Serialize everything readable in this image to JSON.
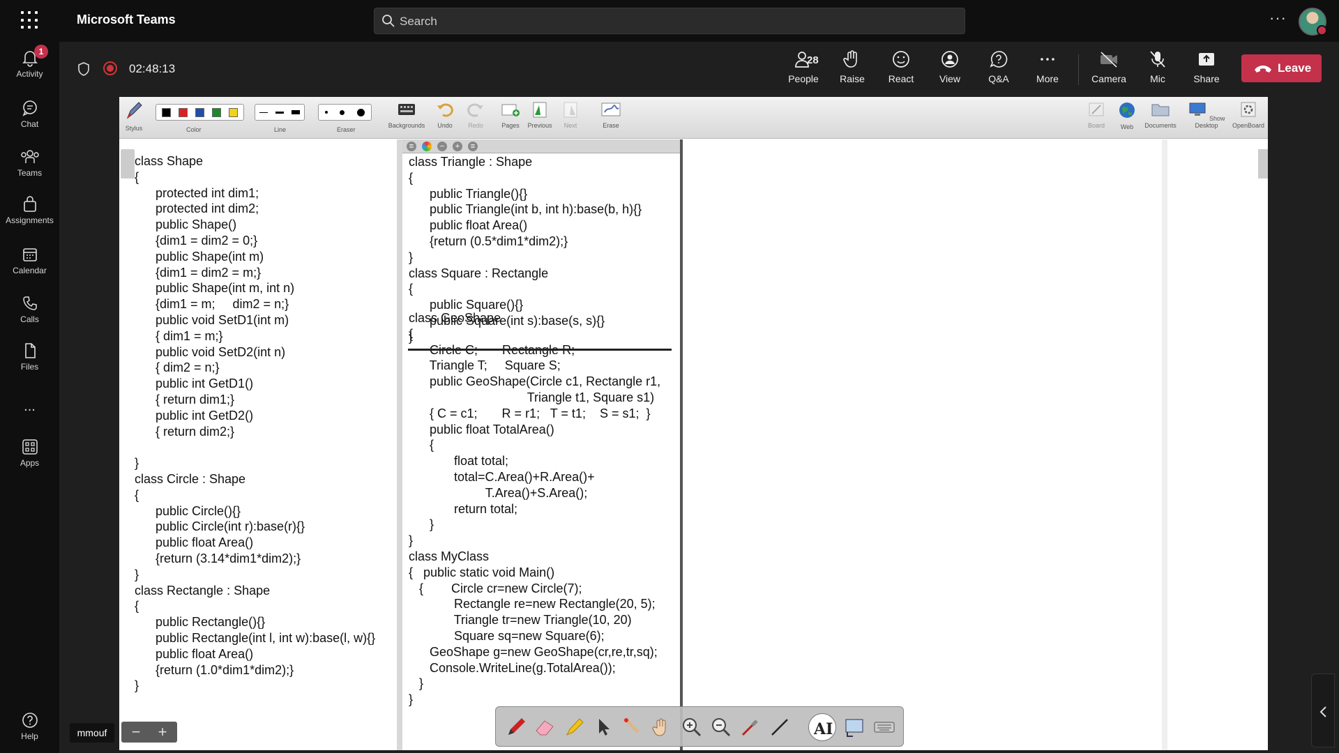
{
  "app": {
    "title": "Microsoft Teams"
  },
  "search": {
    "placeholder": "Search"
  },
  "rail": {
    "activity": {
      "label": "Activity",
      "badge": "1"
    },
    "chat": "Chat",
    "teams": "Teams",
    "assignments": "Assignments",
    "calendar": "Calendar",
    "calls": "Calls",
    "files": "Files",
    "more": "...",
    "apps": "Apps",
    "help": "Help"
  },
  "meeting": {
    "timer": "02:48:13",
    "people_count": "28",
    "people_label": "People",
    "raise_label": "Raise",
    "react_label": "React",
    "view_label": "View",
    "qa_label": "Q&A",
    "more_label": "More",
    "camera_label": "Camera",
    "mic_label": "Mic",
    "share_label": "Share",
    "leave_label": "Leave"
  },
  "openboard": {
    "tools": {
      "stylus": "Stylus",
      "color": "Color",
      "line": "Line",
      "eraser": "Eraser",
      "backgrounds": "Backgrounds",
      "undo": "Undo",
      "redo": "Redo",
      "pages": "Pages",
      "previous": "Previous",
      "next": "Next",
      "erase": "Erase",
      "board": "Board",
      "web": "Web",
      "documents": "Documents",
      "show_desktop": "Show Desktop",
      "openboard": "OpenBoard"
    },
    "colors": [
      "#000000",
      "#e02020",
      "#1f4fa8",
      "#1a8a2a",
      "#f2d21b"
    ],
    "left_code": "class Shape\n{\n      protected int dim1;\n      protected int dim2;\n      public Shape()\n      {dim1 = dim2 = 0;}\n      public Shape(int m)\n      {dim1 = dim2 = m;}\n      public Shape(int m, int n)\n      {dim1 = m;     dim2 = n;}\n      public void SetD1(int m)\n      { dim1 = m;}\n      public void SetD2(int n)\n      { dim2 = n;}\n      public int GetD1()\n      { return dim1;}\n      public int GetD2()\n      { return dim2;}\n\n}\nclass Circle : Shape\n{\n      public Circle(){}\n      public Circle(int r):base(r){}\n      public float Area()\n      {return (3.14*dim1*dim2);}\n}\nclass Rectangle : Shape\n{\n      public Rectangle(){}\n      public Rectangle(int l, int w):base(l, w){}\n      public float Area()\n      {return (1.0*dim1*dim2);}\n}",
    "mid_code_top": "class Triangle : Shape\n{\n      public Triangle(){}\n      public Triangle(int b, int h):base(b, h){}\n      public float Area()\n      {return (0.5*dim1*dim2);}\n}\nclass Square : Rectangle\n{\n      public Square(){}\n      public Square(int s):base(s, s){}\n}",
    "mid_code_bottom": "class GeoShape\n{\n      Circle C;       Rectangle R;\n      Triangle T;     Square S;\n      public GeoShape(Circle c1, Rectangle r1,\n                                  Triangle t1, Square s1)\n      { C = c1;       R = r1;   T = t1;    S = s1;  }\n      public float TotalArea()\n      {\n             float total;\n             total=C.Area()+R.Area()+\n                      T.Area()+S.Area();\n             return total;\n      }\n}\nclass MyClass\n{   public static void Main()\n   {        Circle cr=new Circle(7);\n             Rectangle re=new Rectangle(20, 5);\n             Triangle tr=new Triangle(10, 20)\n             Square sq=new Square(6);\n      GeoShape g=new GeoShape(cr,re,tr,sq);\n      Console.WriteLine(g.TotalArea());\n   }\n}"
  },
  "presenter": {
    "name": "mmouf"
  },
  "zoom": {
    "minus": "−",
    "plus": "+"
  }
}
